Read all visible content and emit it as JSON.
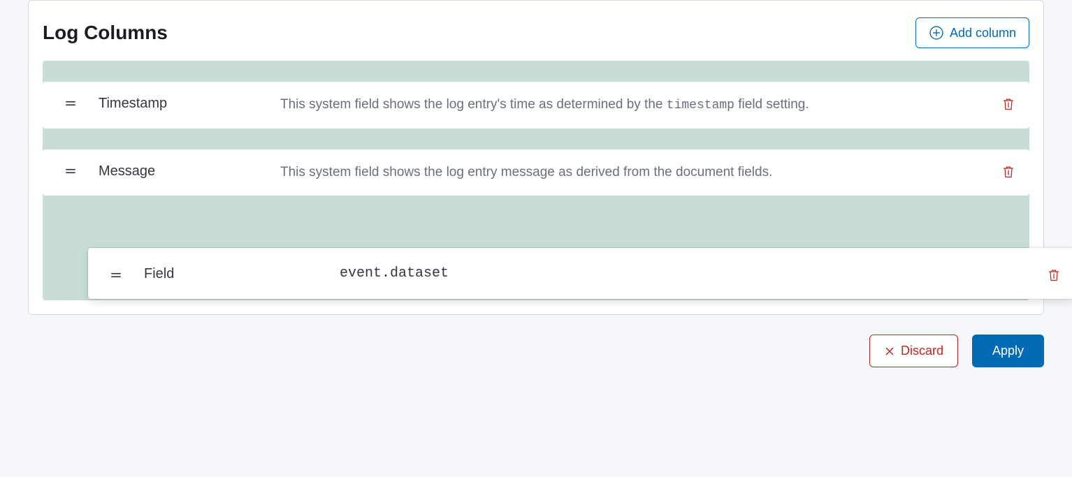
{
  "panel": {
    "title": "Log Columns",
    "add_column_label": "Add column"
  },
  "rows": {
    "timestamp": {
      "name": "Timestamp",
      "desc_prefix": "This system field shows the log entry's time as determined by the ",
      "desc_code": "timestamp",
      "desc_suffix": " field setting."
    },
    "message": {
      "name": "Message",
      "desc": "This system field shows the log entry message as derived from the document fields."
    },
    "field": {
      "name": "Field",
      "value": "event.dataset"
    }
  },
  "actions": {
    "discard": "Discard",
    "apply": "Apply"
  }
}
